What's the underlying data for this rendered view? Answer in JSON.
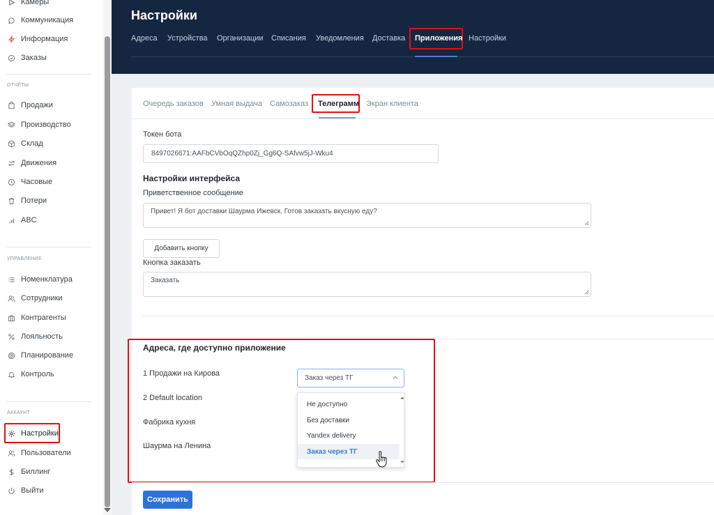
{
  "sidebar": {
    "items_top": [
      {
        "label": "Камеры",
        "icon": "play-icon"
      },
      {
        "label": "Коммуникация",
        "icon": "chat-icon"
      },
      {
        "label": "Информация",
        "icon": "bolt-icon"
      },
      {
        "label": "Заказы",
        "icon": "check-circle-icon"
      }
    ],
    "reports_label": "ОТЧЁТЫ",
    "reports": [
      {
        "label": "Продажи",
        "icon": "bag-icon"
      },
      {
        "label": "Производство",
        "icon": "layers-icon"
      },
      {
        "label": "Склад",
        "icon": "box-icon"
      },
      {
        "label": "Движения",
        "icon": "swap-icon"
      },
      {
        "label": "Часовые",
        "icon": "clock-icon"
      },
      {
        "label": "Потери",
        "icon": "trash-icon"
      },
      {
        "label": "ABC",
        "icon": "bar-chart-icon"
      }
    ],
    "management_label": "УПРАВЛЕНИЕ",
    "management": [
      {
        "label": "Номенклатура",
        "icon": "list-icon"
      },
      {
        "label": "Сотрудники",
        "icon": "users-icon"
      },
      {
        "label": "Контрагенты",
        "icon": "briefcase-icon"
      },
      {
        "label": "Лояльность",
        "icon": "percent-icon"
      },
      {
        "label": "Планирование",
        "icon": "target-icon"
      },
      {
        "label": "Контроль",
        "icon": "bell-icon"
      }
    ],
    "account_label": "АККАУНТ",
    "account": [
      {
        "label": "Настройки",
        "icon": "gear-icon"
      },
      {
        "label": "Пользователи",
        "icon": "users-icon"
      },
      {
        "label": "Биллинг",
        "icon": "dollar-icon"
      },
      {
        "label": "Выйти",
        "icon": "power-icon"
      }
    ]
  },
  "header": {
    "title": "Настройки",
    "tabs": [
      "Адреса",
      "Устройства",
      "Организации",
      "Списания",
      "Уведомления",
      "Доставка",
      "Приложения",
      "Настройки"
    ],
    "active_tab": "Приложения"
  },
  "subtabs": {
    "items": [
      "Очередь заказов",
      "Умная выдача",
      "Самозаказ",
      "Телеграмм",
      "Экран клиента"
    ],
    "active": "Телеграмм"
  },
  "form": {
    "token_label": "Токен бота",
    "token_value": "8497026671:AAFbCVbOqQZhp0Zj_Gg6Q-SAfvw5jJ-Wku4",
    "interface_heading": "Настройки интерфейса",
    "welcome_label": "Приветственное сообщение",
    "welcome_value": "Привет! Я бот доставки Шаурма Ижевск. Готов заказать вкусную еду?",
    "add_button_label": "Добавить кнопку",
    "order_button_label": "Кнопка заказать",
    "order_button_value": "Заказать"
  },
  "addresses": {
    "heading": "Адреса, где доступно приложение",
    "rows": [
      "1 Продажи на Кирова",
      "2 Default location",
      "Фабрика кухня",
      "Шаурма на Ленина"
    ],
    "selected_value": "Заказ через ТГ",
    "options": [
      "Не доступно",
      "Без доставки",
      "Yandex delivery",
      "Заказ через ТГ"
    ]
  },
  "save_label": "Сохранить",
  "colors": {
    "header_bg": "#152740",
    "primary": "#2d72d9",
    "highlight": "#e01010",
    "selected_option": "#3a7bd5"
  }
}
